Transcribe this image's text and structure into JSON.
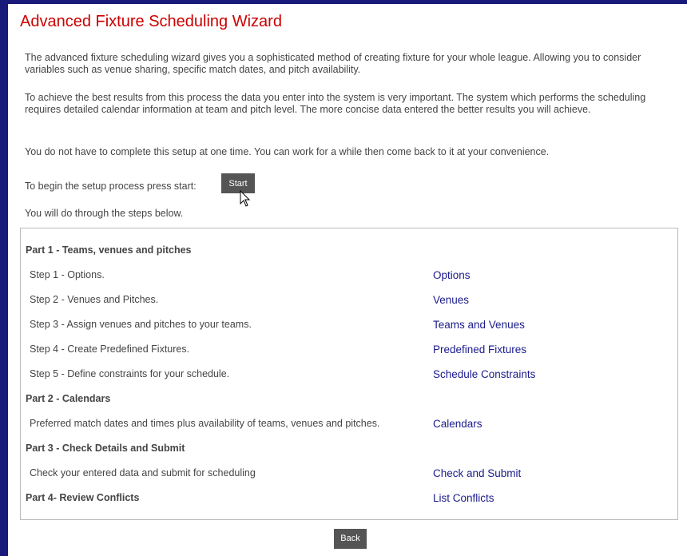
{
  "header": {
    "title": "Advanced Fixture Scheduling Wizard"
  },
  "intro": {
    "p1": "The advanced fixture scheduling wizard gives you a sophisticated method of creating fixture for your whole league. Allowing you to consider variables such as venue sharing, specific match dates, and pitch availability.",
    "p2": "To achieve the best results from this process the data you enter into the system is very important. The system which performs the scheduling requires detailed calendar information at team and pitch level. The more concise data entered the better results you will achieve.",
    "p3": "You do not have to complete this setup at one time. You can work for a while then come back to it at your convenience.",
    "start_label": "To begin the setup process press start:",
    "start_button": "Start",
    "steps_intro": "You will do through the steps below."
  },
  "parts": [
    {
      "title": "Part 1 - Teams, venues and pitches",
      "steps": [
        {
          "text": "Step 1 - Options.",
          "link": "Options"
        },
        {
          "text": "Step 2 - Venues and Pitches.",
          "link": "Venues"
        },
        {
          "text": "Step 3 - Assign venues and pitches to your teams.",
          "link": "Teams and Venues"
        },
        {
          "text": "Step 4 - Create Predefined Fixtures.",
          "link": "Predefined Fixtures"
        },
        {
          "text": "Step 5 - Define constraints for your schedule.",
          "link": "Schedule Constraints"
        }
      ]
    },
    {
      "title": "Part 2 - Calendars",
      "steps": [
        {
          "text": "Preferred match dates and times plus availability of teams, venues and pitches.",
          "link": "Calendars"
        }
      ]
    },
    {
      "title": "Part 3 - Check Details and Submit",
      "steps": [
        {
          "text": "Check your entered data and submit for scheduling",
          "link": "Check and Submit"
        }
      ]
    },
    {
      "title": "Part 4- Review Conflicts",
      "link": "List Conflicts"
    }
  ],
  "footer": {
    "back_button": "Back"
  },
  "colors": {
    "title": "#cc0000",
    "link": "#1a1a8c",
    "button": "#555555",
    "frame": "#1a1a7a"
  },
  "icons": {
    "pointer": "mouse-pointer-icon"
  }
}
